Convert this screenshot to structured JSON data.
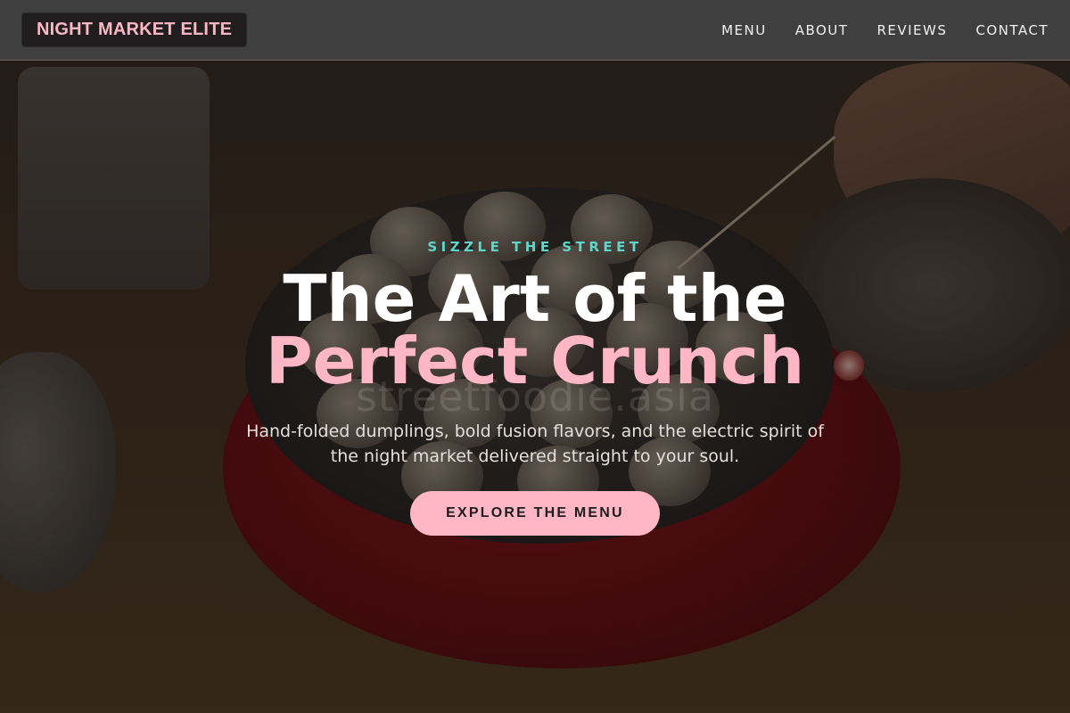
{
  "brand": {
    "logo_text": "NIGHT MARKET ELITE"
  },
  "nav": {
    "items": [
      {
        "label": "MENU"
      },
      {
        "label": "ABOUT"
      },
      {
        "label": "REVIEWS"
      },
      {
        "label": "CONTACT"
      }
    ]
  },
  "hero": {
    "kicker": "SIZZLE THE STREET",
    "title_line1": "The Art of the",
    "title_line2": "Perfect Crunch",
    "description": "Hand-folded dumplings, bold fusion flavors, and the electric spirit of the night market delivered straight to your soul.",
    "cta_label": "EXPLORE THE MENU",
    "watermark": "streetfoodie.asia"
  },
  "colors": {
    "accent_pink": "#ffb7c5",
    "accent_teal": "#5fd6c8",
    "nav_bg": "#3f3f3f"
  }
}
